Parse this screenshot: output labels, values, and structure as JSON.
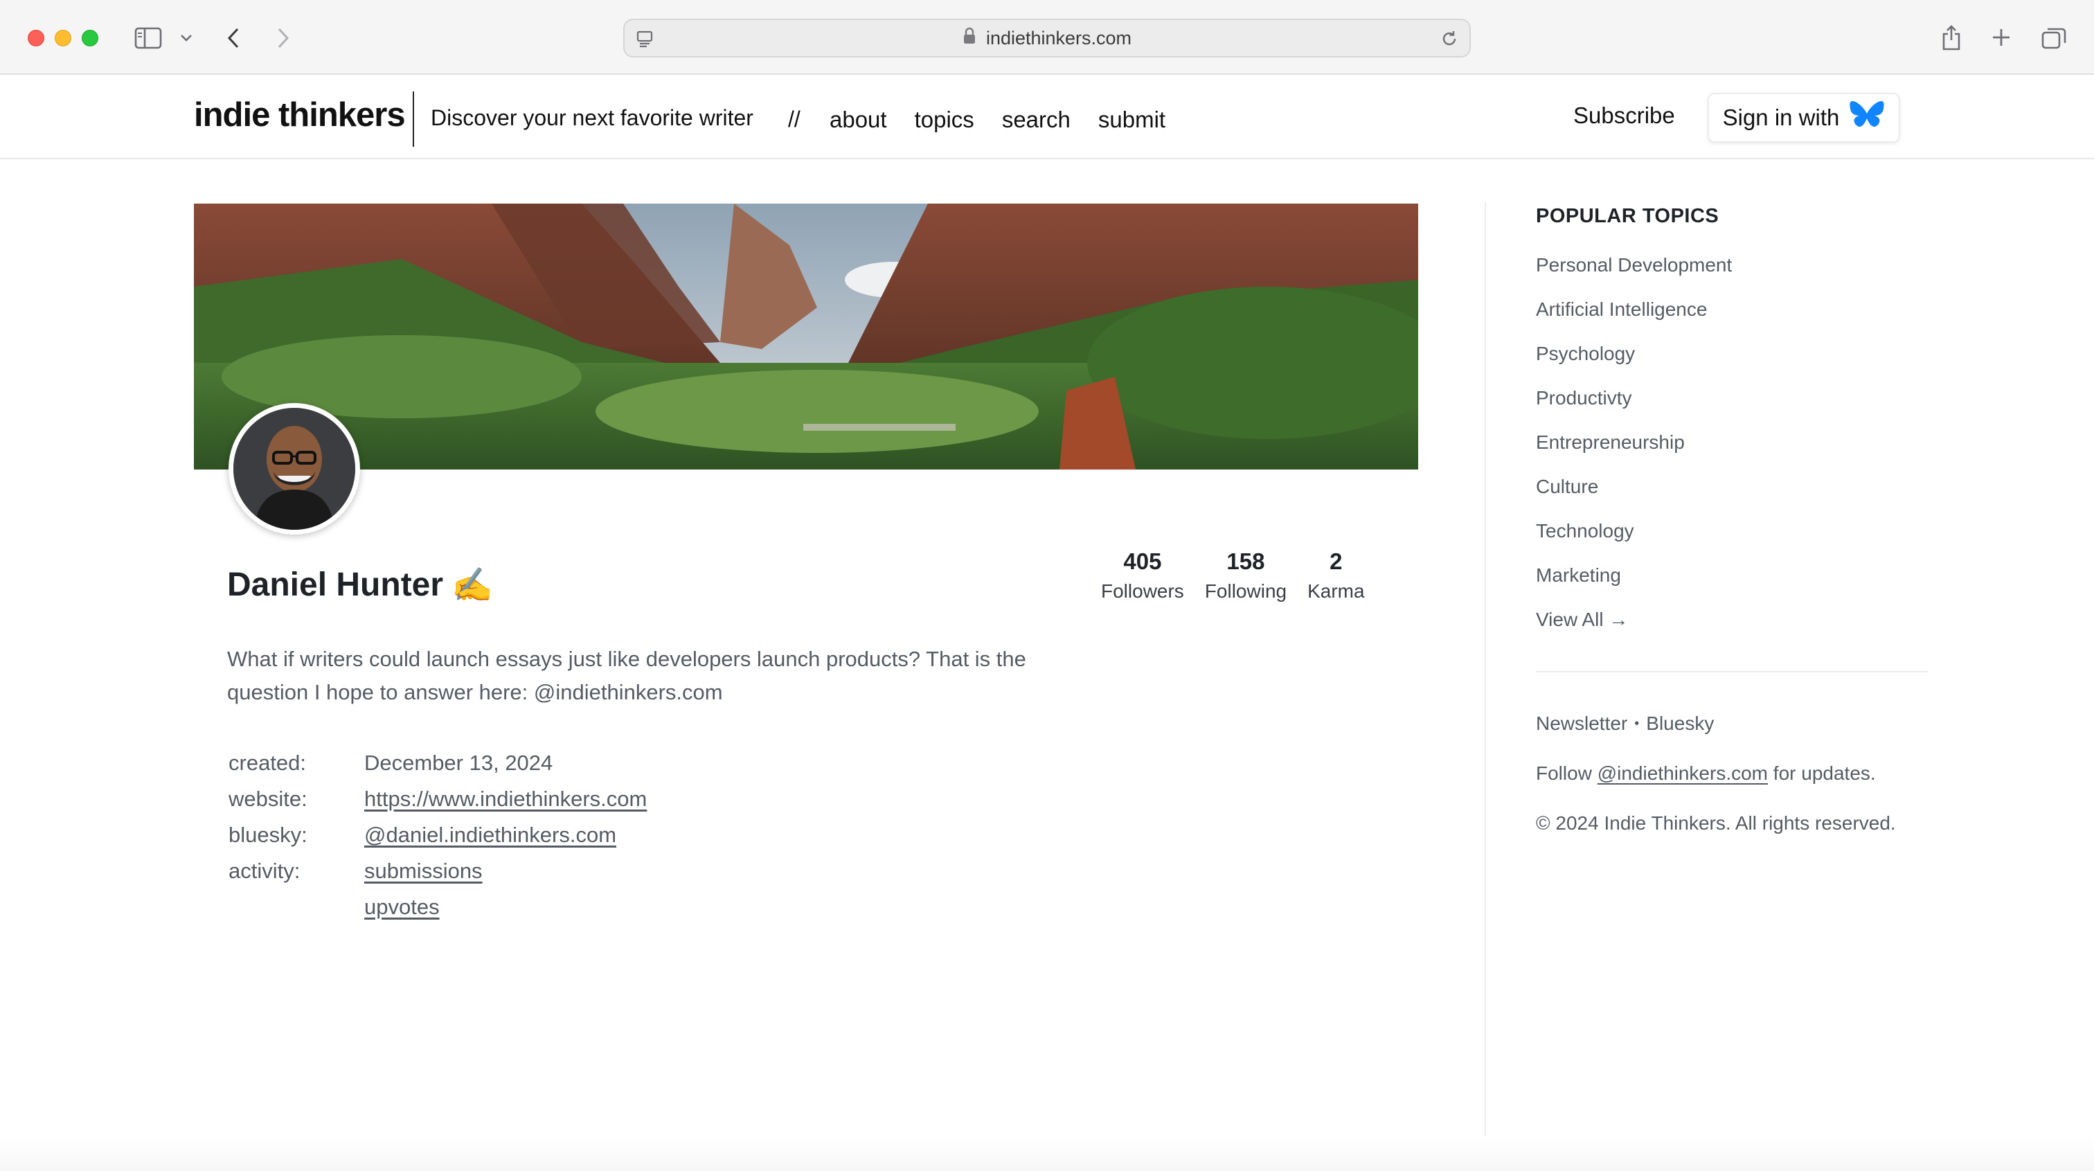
{
  "browser": {
    "url": "indiethinkers.com"
  },
  "header": {
    "logo": "indie thinkers",
    "tagline": "Discover your next favorite writer",
    "separator": "//",
    "nav": [
      "about",
      "topics",
      "search",
      "submit"
    ],
    "subscribe_label": "Subscribe",
    "signin_label": "Sign in with",
    "bluesky_color": "#1185fe"
  },
  "profile": {
    "name": "Daniel Hunter",
    "name_emoji": "✍️",
    "stats": [
      {
        "value": "405",
        "label": "Followers"
      },
      {
        "value": "158",
        "label": "Following"
      },
      {
        "value": "2",
        "label": "Karma"
      }
    ],
    "bio": "What if writers could launch essays just like developers launch products? That is the question I hope to answer here: @indiethinkers.com",
    "meta": {
      "created_key": "created:",
      "created_val": "December 13, 2024",
      "website_key": "website:",
      "website_val": "https://www.indiethinkers.com",
      "bluesky_key": "bluesky:",
      "bluesky_val": "@daniel.indiethinkers.com",
      "activity_key": "activity:",
      "activity_links": [
        "submissions",
        "upvotes"
      ]
    }
  },
  "sidebar": {
    "heading": "POPULAR TOPICS",
    "topics": [
      "Personal Development",
      "Artificial Intelligence",
      "Psychology",
      "Productivty",
      "Entrepreneurship",
      "Culture",
      "Technology",
      "Marketing",
      "View All →"
    ],
    "footer": {
      "newsletter": "Newsletter",
      "dot": "•",
      "bluesky": "Bluesky",
      "follow_prefix": "Follow",
      "follow_handle": "@indiethinkers.com",
      "follow_suffix": "for updates.",
      "copyright": "© 2024 Indie Thinkers. All rights reserved."
    }
  }
}
